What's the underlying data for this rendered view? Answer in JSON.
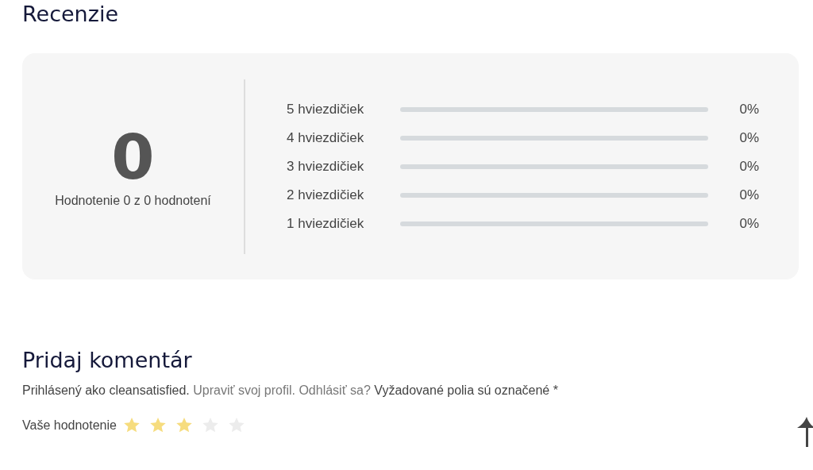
{
  "reviews": {
    "title": "Recenzie",
    "summary": {
      "score": "0",
      "caption": "Hodnotenie 0 z 0 hodnotení"
    },
    "breakdown": [
      {
        "label": "5 hviezdičiek",
        "percent": "0%"
      },
      {
        "label": "4 hviezdičiek",
        "percent": "0%"
      },
      {
        "label": "3 hviezdičiek",
        "percent": "0%"
      },
      {
        "label": "2 hviezdičiek",
        "percent": "0%"
      },
      {
        "label": "1 hviezdičiek",
        "percent": "0%"
      }
    ]
  },
  "comment_form": {
    "title": "Pridaj komentár",
    "logged_in_as": "Prihlásený ako cleansatisfied.",
    "edit_profile_link": "Upraviť svoj profil.",
    "logout_link": "Odhlásiť sa?",
    "required_note": "Vyžadované polia sú označené *",
    "rating": {
      "label": "Vaše hodnotenie",
      "stars": 3
    }
  }
}
